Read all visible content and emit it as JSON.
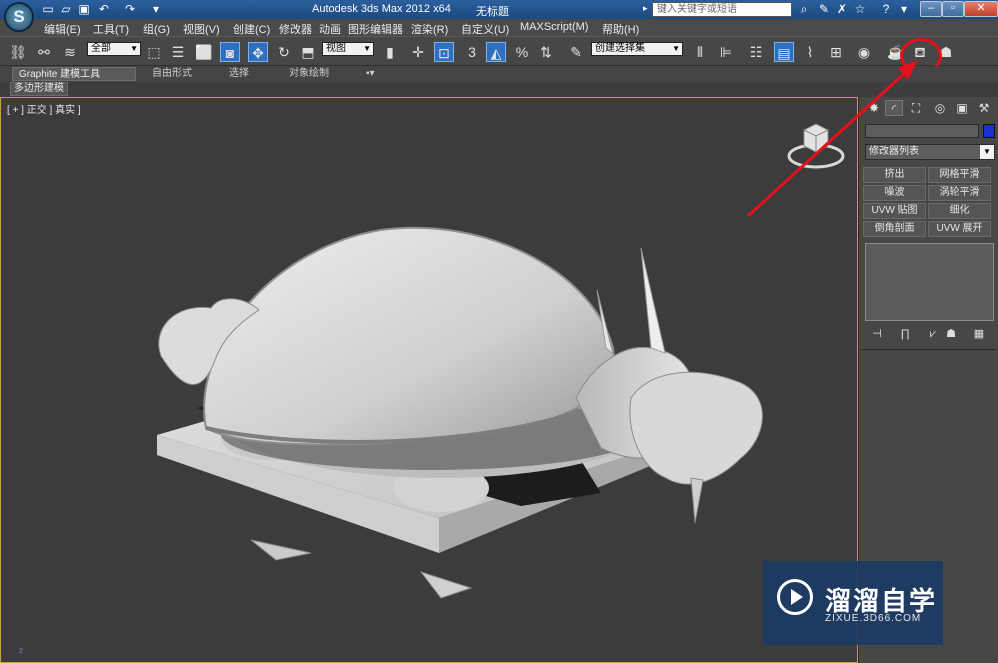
{
  "app": {
    "logo_letter": "S",
    "title": "Autodesk 3ds Max  2012 x64",
    "document": "无标题",
    "search_placeholder": "键入关键字或短语"
  },
  "menu": [
    "编辑(E)",
    "工具(T)",
    "组(G)",
    "视图(V)",
    "创建(C)",
    "修改器",
    "动画",
    "图形编辑器",
    "渲染(R)",
    "自定义(U)",
    "MAXScript(M)",
    "帮助(H)"
  ],
  "toolbar": {
    "selection_filter": "全部",
    "ref_coord": "视图",
    "snap_label": "3",
    "named_selection": "创建选择集"
  },
  "ribbon": {
    "tabs": [
      "Graphite 建模工具",
      "自由形式",
      "选择",
      "对象绘制"
    ],
    "subtab": "多边形建模"
  },
  "viewport": {
    "label": "[ + ] 正交 ] 真实 ]",
    "axis": "z"
  },
  "command_panel": {
    "modifier_list": "修改器列表",
    "modifier_buttons": [
      "挤出",
      "网格平滑",
      "噪波",
      "涡轮平滑",
      "UVW 贴图",
      "细化",
      "倒角剖面",
      "UVW 展开"
    ]
  },
  "watermark": {
    "title": "溜溜自学",
    "url": "ZIXUE.3D66.COM"
  },
  "colors": {
    "accent_blue": "#2f6fc0",
    "highlight_red": "#e4101a",
    "object_color": "#1a2fd0"
  }
}
